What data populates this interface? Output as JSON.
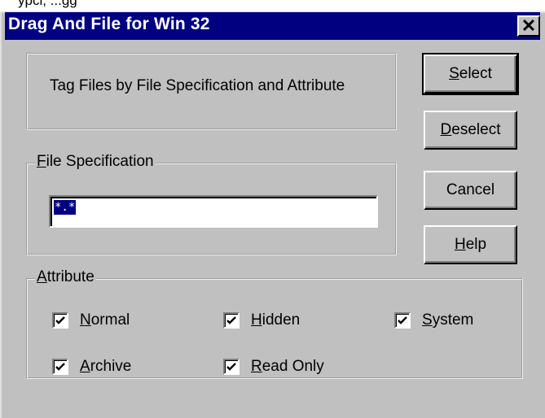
{
  "top_caption": "ypci, ...gg",
  "window": {
    "title": "Drag And File for Win 32",
    "close_glyph": "✕"
  },
  "info": {
    "text": "Tag Files by File Specification and Attribute"
  },
  "buttons": {
    "select": {
      "mnemonic": "S",
      "rest": "elect"
    },
    "deselect": {
      "mnemonic": "D",
      "rest": "eselect"
    },
    "cancel": {
      "label": "Cancel"
    },
    "help": {
      "mnemonic": "H",
      "rest": "elp"
    }
  },
  "file_spec": {
    "mnemonic": "F",
    "rest": "ile Specification",
    "value": "*.*"
  },
  "attribute": {
    "mnemonic": "A",
    "rest": "ttribute",
    "normal": {
      "mnemonic": "N",
      "rest": "ormal",
      "checked": true
    },
    "hidden": {
      "mnemonic": "H",
      "rest": "idden",
      "checked": true
    },
    "system": {
      "mnemonic": "S",
      "rest": "ystem",
      "checked": true
    },
    "archive": {
      "mnemonic": "A",
      "rest": "rchive",
      "checked": true
    },
    "readonly": {
      "mnemonic": "R",
      "rest": "ead Only",
      "checked": true
    }
  },
  "colors": {
    "titlebar": "#000080",
    "face": "#c0c0c0",
    "selection": "#000080"
  }
}
